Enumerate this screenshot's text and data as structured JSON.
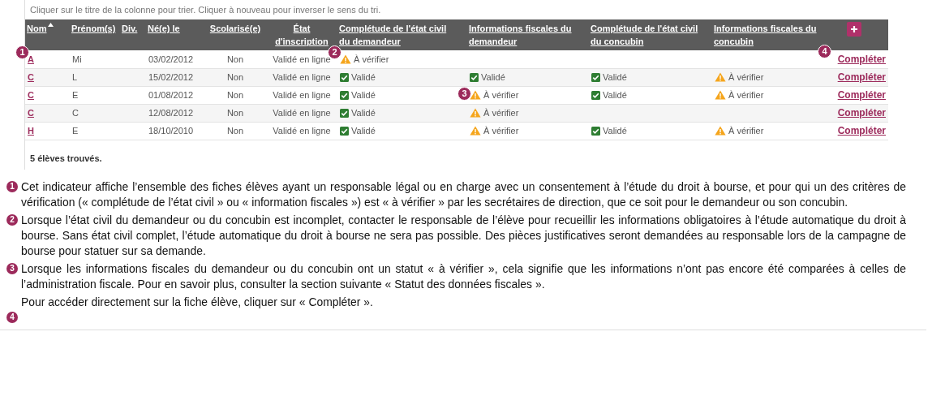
{
  "hint": "Cliquer sur le titre de la colonne pour trier. Cliquer à nouveau pour inverser le sens du tri.",
  "table": {
    "columns": [
      {
        "label": "Nom",
        "sorted": true
      },
      {
        "label": "Prénom(s)",
        "sorted": false
      },
      {
        "label": "Div.",
        "sorted": false
      },
      {
        "label": "Né(e) le",
        "sorted": false
      },
      {
        "label": "Scolarisé(e)",
        "sorted": false
      },
      {
        "label": "État d'inscription",
        "sorted": false
      },
      {
        "label": "Complétude de l'état civil du demandeur",
        "sorted": false
      },
      {
        "label": "Informations fiscales du demandeur",
        "sorted": false
      },
      {
        "label": "Complétude de l'état civil du concubin",
        "sorted": false
      },
      {
        "label": "Informations fiscales du concubin",
        "sorted": false
      },
      {
        "kind": "add"
      }
    ],
    "rows": [
      {
        "cells": [
          {
            "kind": "link",
            "text": "A",
            "marker": "1"
          },
          {
            "kind": "plain",
            "text": "Mi"
          },
          {
            "kind": "empty"
          },
          {
            "kind": "plain",
            "text": "03/02/2012"
          },
          {
            "kind": "plain",
            "text": "Non"
          },
          {
            "kind": "plain",
            "text": "Validé en ligne"
          },
          {
            "kind": "warn",
            "text": "À vérifier",
            "marker": "2"
          },
          {
            "kind": "empty"
          },
          {
            "kind": "empty"
          },
          {
            "kind": "empty"
          },
          {
            "kind": "action",
            "text": "Compléter",
            "marker": "4"
          }
        ]
      },
      {
        "cells": [
          {
            "kind": "link",
            "text": "C"
          },
          {
            "kind": "plain",
            "text": "L"
          },
          {
            "kind": "empty"
          },
          {
            "kind": "plain",
            "text": "15/02/2012"
          },
          {
            "kind": "plain",
            "text": "Non"
          },
          {
            "kind": "plain",
            "text": "Validé en ligne"
          },
          {
            "kind": "ok",
            "text": "Validé"
          },
          {
            "kind": "ok",
            "text": "Validé"
          },
          {
            "kind": "ok",
            "text": "Validé"
          },
          {
            "kind": "warn",
            "text": "À vérifier"
          },
          {
            "kind": "action",
            "text": "Compléter"
          }
        ]
      },
      {
        "cells": [
          {
            "kind": "link",
            "text": "C"
          },
          {
            "kind": "plain",
            "text": "E"
          },
          {
            "kind": "empty"
          },
          {
            "kind": "plain",
            "text": "01/08/2012"
          },
          {
            "kind": "plain",
            "text": "Non"
          },
          {
            "kind": "plain",
            "text": "Validé en ligne"
          },
          {
            "kind": "ok",
            "text": "Validé"
          },
          {
            "kind": "warn",
            "text": "À vérifier",
            "marker": "3"
          },
          {
            "kind": "ok",
            "text": "Validé"
          },
          {
            "kind": "warn",
            "text": "À vérifier"
          },
          {
            "kind": "action",
            "text": "Compléter"
          }
        ]
      },
      {
        "cells": [
          {
            "kind": "link",
            "text": "C"
          },
          {
            "kind": "plain",
            "text": "C"
          },
          {
            "kind": "empty"
          },
          {
            "kind": "plain",
            "text": "12/08/2012"
          },
          {
            "kind": "plain",
            "text": "Non"
          },
          {
            "kind": "plain",
            "text": "Validé en ligne"
          },
          {
            "kind": "ok",
            "text": "Validé"
          },
          {
            "kind": "warn",
            "text": "À vérifier"
          },
          {
            "kind": "empty"
          },
          {
            "kind": "empty"
          },
          {
            "kind": "action",
            "text": "Compléter"
          }
        ]
      },
      {
        "cells": [
          {
            "kind": "link",
            "text": "H"
          },
          {
            "kind": "plain",
            "text": "E"
          },
          {
            "kind": "empty"
          },
          {
            "kind": "plain",
            "text": "18/10/2010"
          },
          {
            "kind": "plain",
            "text": "Non"
          },
          {
            "kind": "plain",
            "text": "Validé en ligne"
          },
          {
            "kind": "ok",
            "text": "Validé"
          },
          {
            "kind": "warn",
            "text": "À vérifier"
          },
          {
            "kind": "ok",
            "text": "Validé"
          },
          {
            "kind": "warn",
            "text": "À vérifier"
          },
          {
            "kind": "action",
            "text": "Compléter"
          }
        ]
      }
    ]
  },
  "result_count": "5 élèves trouvés.",
  "notes": [
    {
      "marker": "1",
      "kind": "marker_first",
      "text": "Cet indicateur affiche l’ensemble des fiches élèves ayant un responsable légal ou en charge avec un consentement à l’étude du droit à bourse, et pour qui un des critères de vérification (« complétude de l’état civil » ou « information fiscales ») est « à vérifier » par les secrétaires de direction, que ce soit pour le demandeur ou son concubin."
    },
    {
      "marker": "2",
      "kind": "marker_first",
      "text": "Lorsque l’état civil du demandeur ou du concubin est incomplet, contacter le responsable de l’élève pour recueillir les informations obligatoires à l’étude automatique du droit à bourse. Sans état civil complet, l’étude automatique du droit à bourse ne sera pas possible. Des pièces justificatives seront demandées au responsable lors de la campagne de bourse pour statuer sur sa demande."
    },
    {
      "marker": "3",
      "kind": "marker_first",
      "text": "Lorsque les informations fiscales du demandeur ou du concubin ont un statut « à vérifier », cela signifie que les informations n’ont pas encore été comparées à celles de l’administration fiscale. Pour en savoir plus, consulter la section suivante « Statut des données fiscales »."
    },
    {
      "marker": "4",
      "kind": "marker_after",
      "text": "Pour accéder directement sur la fiche élève, cliquer sur « Compléter »."
    }
  ]
}
